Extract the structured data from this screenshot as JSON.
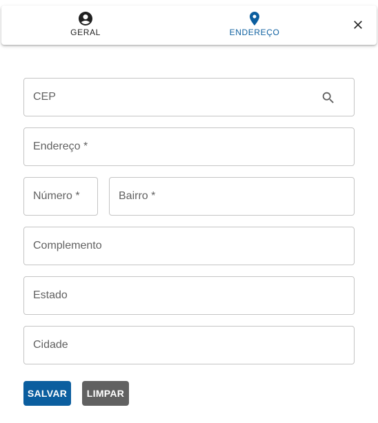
{
  "tabs": [
    {
      "label": "GERAL",
      "icon": "account-circle-icon",
      "active": false
    },
    {
      "label": "ENDEREÇO",
      "icon": "map-pin-icon",
      "active": true
    }
  ],
  "close_icon": "close-icon",
  "form": {
    "cep": {
      "placeholder": "CEP",
      "value": ""
    },
    "endereco": {
      "placeholder": "Endereço *",
      "value": ""
    },
    "numero": {
      "placeholder": "Número *",
      "value": ""
    },
    "bairro": {
      "placeholder": "Bairro *",
      "value": ""
    },
    "complemento": {
      "placeholder": "Complemento",
      "value": ""
    },
    "estado": {
      "placeholder": "Estado",
      "value": ""
    },
    "cidade": {
      "placeholder": "Cidade",
      "value": ""
    }
  },
  "actions": {
    "save_label": "SALVAR",
    "clear_label": "LIMPAR"
  },
  "colors": {
    "primary": "#0b5e9f",
    "secondary_button": "#616161",
    "field_border": "#c4c4c4"
  }
}
